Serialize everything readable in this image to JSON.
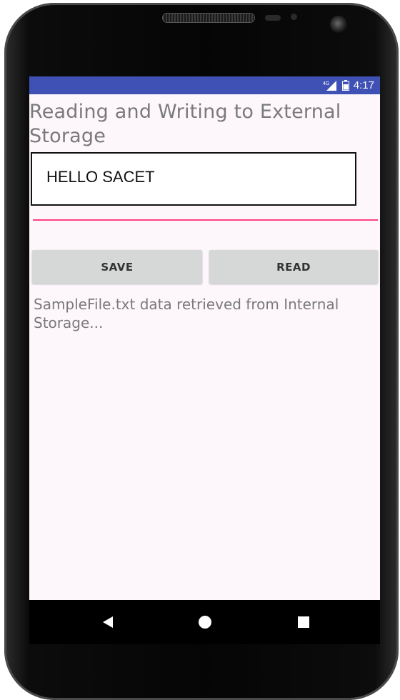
{
  "status_bar": {
    "network": "4G",
    "time": "4:17"
  },
  "app": {
    "title": "Reading and Writing to External Storage",
    "text_box_value": "HELLO SACET",
    "input_value": "",
    "save_label": "SAVE",
    "read_label": "READ",
    "result_message": "SampleFile.txt data retrieved from Internal Storage..."
  },
  "navigation": {
    "back_icon": "back-triangle-icon",
    "home_icon": "home-circle-icon",
    "recents_icon": "recents-square-icon"
  },
  "colors": {
    "status_bar": "#3f51b5",
    "accent": "#ff4081",
    "button": "#d6d7d7",
    "screen_bg": "#fdf6fb"
  }
}
